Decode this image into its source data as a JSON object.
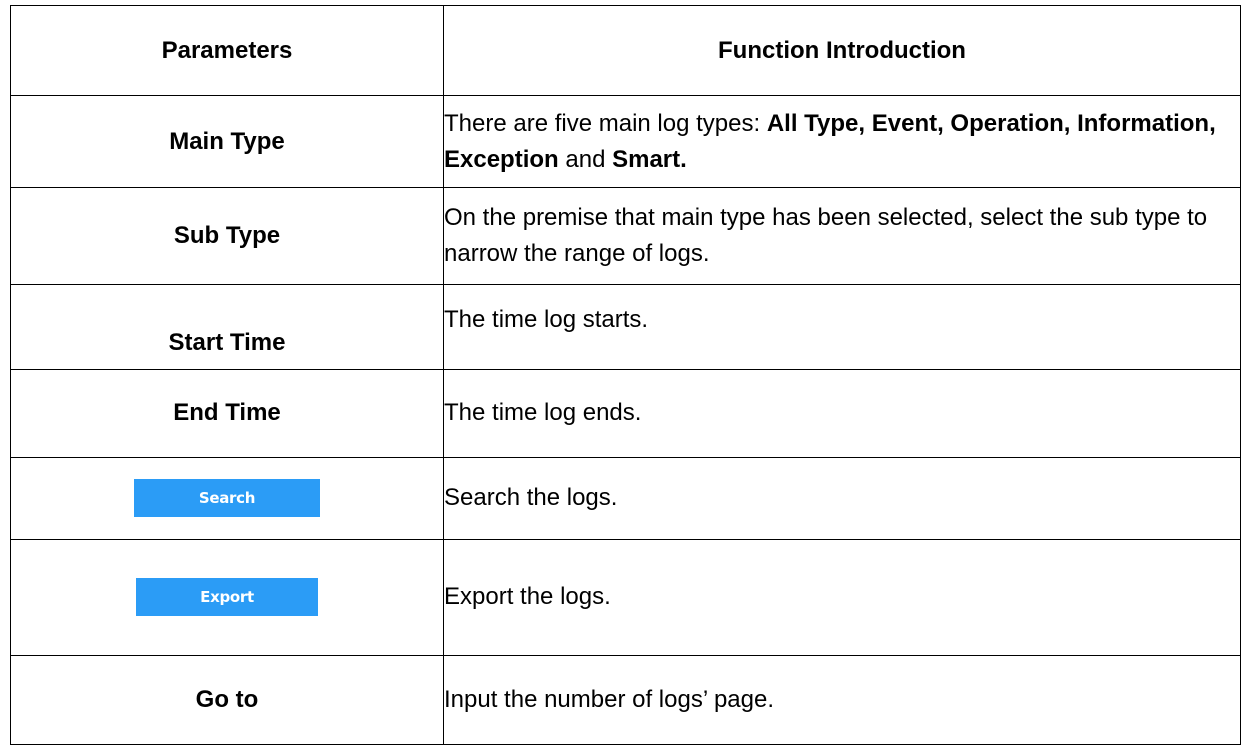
{
  "header": {
    "parameters": "Parameters",
    "function_introduction": "Function Introduction"
  },
  "rows": {
    "main_type": {
      "param": "Main Type",
      "desc_lead": "There are five main log types: ",
      "types_a": "All Type, Event, Operation, Information, Exception",
      "conj": " and ",
      "types_b": "Smart."
    },
    "sub_type": {
      "param": "Sub Type",
      "desc": "On the premise that main type has been selected, select the sub type to narrow the range of logs."
    },
    "start_time": {
      "param": "Start Time",
      "desc": "The time log starts."
    },
    "end_time": {
      "param": "End Time",
      "desc": "The time log ends."
    },
    "search": {
      "button_label": "Search",
      "desc": "Search the logs."
    },
    "export": {
      "button_label": "Export",
      "desc": "Export the logs."
    },
    "go_to": {
      "param": "Go to",
      "desc": "Input the number of logs’ page."
    }
  },
  "colors": {
    "button_bg": "#2b9cf6",
    "button_text": "#ffffff",
    "border": "#000000"
  }
}
